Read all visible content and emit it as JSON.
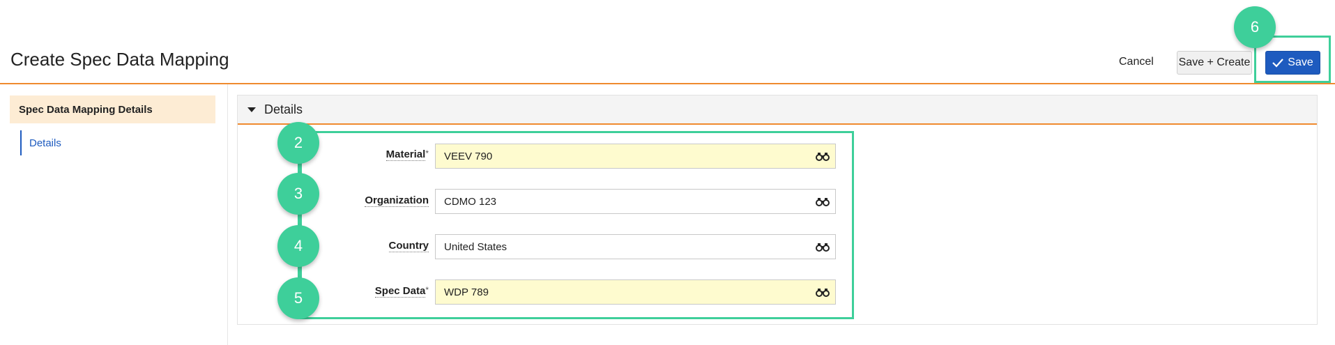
{
  "header": {
    "title": "Create Spec Data Mapping",
    "cancel_label": "Cancel",
    "save_create_label": "Save + Create",
    "save_label": "Save"
  },
  "sidebar": {
    "section": "Spec Data Mapping Details",
    "items": [
      {
        "label": "Details"
      }
    ]
  },
  "details": {
    "section_title": "Details",
    "fields": [
      {
        "label": "Material",
        "value": "VEEV 790",
        "required": true
      },
      {
        "label": "Organization",
        "value": "CDMO 123",
        "required": false
      },
      {
        "label": "Country",
        "value": "United States",
        "required": false
      },
      {
        "label": "Spec Data",
        "value": "WDP 789",
        "required": true
      }
    ]
  },
  "callouts": [
    "2",
    "3",
    "4",
    "5",
    "6"
  ],
  "required_mark": "*",
  "icons": {
    "lookup": "binoculars-icon",
    "save": "checkmark-icon",
    "section_toggle": "caret-down-icon"
  },
  "colors": {
    "accent_orange": "#ef8a2e",
    "primary_blue": "#1e5bbf",
    "highlight_green": "#3ecf9a",
    "required_yellow": "#fefbcf",
    "sidebar_active": "#fdecd4"
  }
}
